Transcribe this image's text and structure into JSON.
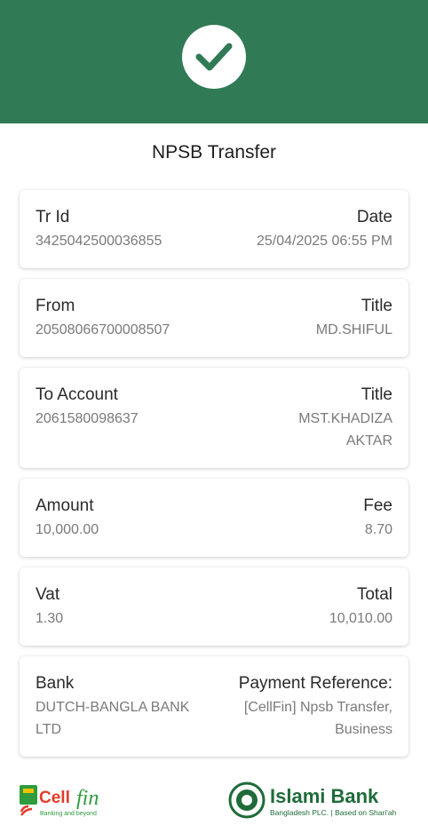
{
  "header": {
    "status_icon": "check-icon",
    "accent": "#307a55"
  },
  "title": "NPSB Transfer",
  "cards": [
    {
      "left_label": "Tr Id",
      "left_value": "3425042500036855",
      "right_label": "Date",
      "right_value": "25/04/2025 06:55 PM"
    },
    {
      "left_label": "From",
      "left_value": "20508066700008507",
      "right_label": "Title",
      "right_value": "MD.SHIFUL"
    },
    {
      "left_label": "To Account",
      "left_value": "2061580098637",
      "right_label": "Title",
      "right_value_lines": [
        "MST.KHADIZA",
        "AKTAR"
      ]
    },
    {
      "left_label": "Amount",
      "left_value": "10,000.00",
      "right_label": "Fee",
      "right_value": "8.70"
    },
    {
      "left_label": "Vat",
      "left_value": "1.30",
      "right_label": "Total",
      "right_value": "10,010.00"
    },
    {
      "left_label": "Bank",
      "left_value_lines": [
        "DUTCH-BANGLA BANK",
        "LTD"
      ],
      "right_label": "Payment Reference:",
      "right_value_lines": [
        "[CellFin] Npsb Transfer,",
        "Business"
      ]
    }
  ],
  "footer": {
    "cellfin": {
      "name_cell": "Cell",
      "name_fin": "fin",
      "tagline": "Banking and beyond"
    },
    "ibbl": {
      "name": "Islami Bank",
      "tagline": "Bangladesh PLC. | Based on Shari'ah"
    }
  }
}
